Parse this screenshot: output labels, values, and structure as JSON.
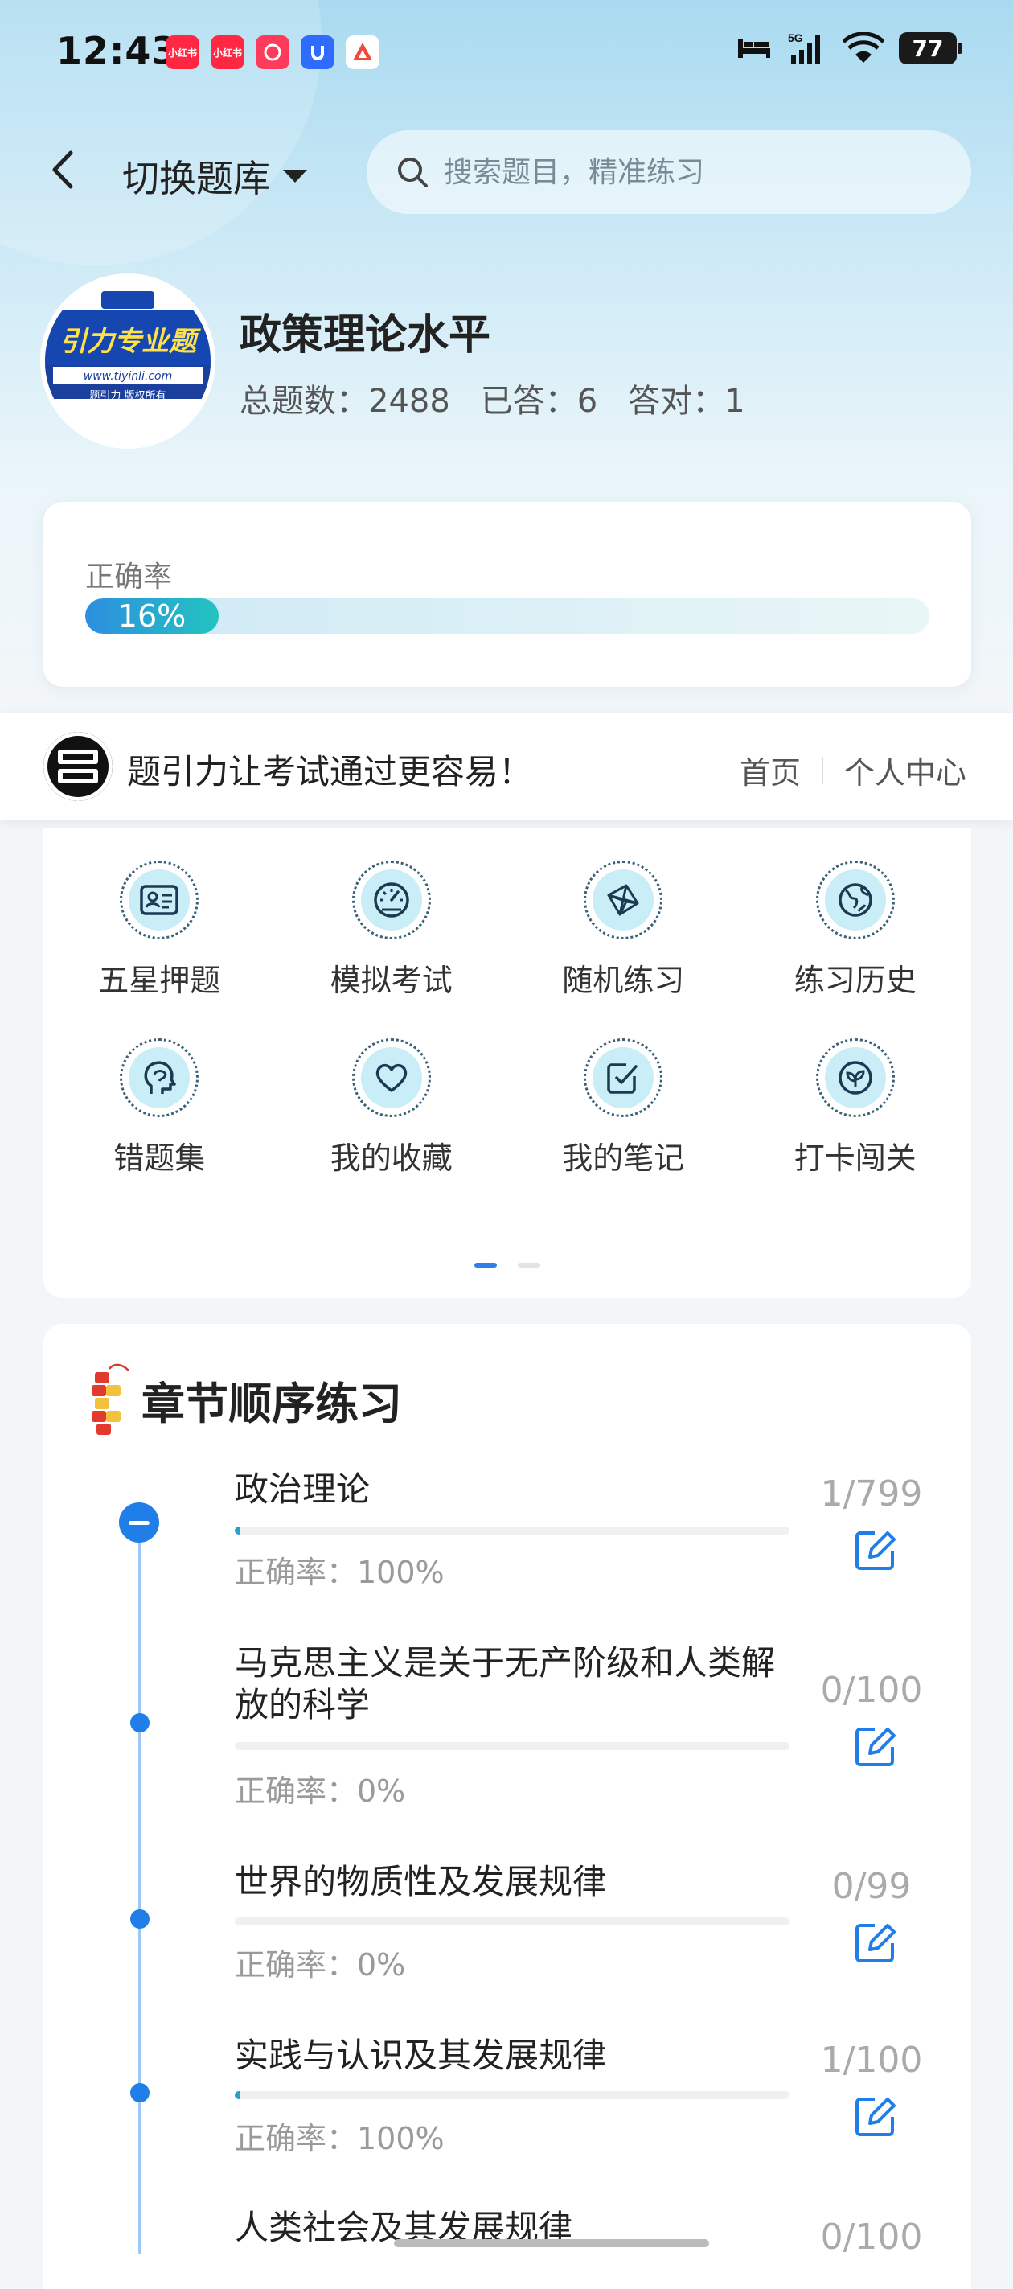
{
  "status_bar": {
    "time": "12:43",
    "apps": [
      {
        "name": "xiaohongshu-1",
        "label": "小红书",
        "color": "#ff2741"
      },
      {
        "name": "xiaohongshu-2",
        "label": "小红书",
        "color": "#ff2741"
      },
      {
        "name": "app-3",
        "label": "",
        "color": "#ff3b5c"
      },
      {
        "name": "app-4",
        "label": "",
        "color": "#2f6bff"
      },
      {
        "name": "app-5",
        "label": "",
        "color": "#f04a3a"
      }
    ],
    "network": "5G",
    "battery": "77"
  },
  "header": {
    "switch_label": "切换题库",
    "search_placeholder": "搜索题目，精准练习"
  },
  "profile": {
    "logo_text": "引力专业题",
    "logo_url_text": "www.tiyinli.com",
    "logo_copyright": "题引力 版权所有",
    "title": "政策理论水平",
    "total_label": "总题数：2488",
    "answered_label": "已答：6",
    "correct_label": "答对：1"
  },
  "accuracy": {
    "label": "正确率",
    "value_text": "16%",
    "value": 0.16
  },
  "banner": {
    "text": "题引力让考试通过更容易！",
    "links": [
      "首页",
      "个人中心"
    ]
  },
  "grid": [
    {
      "label": "五星押题",
      "icon": "id-card-icon"
    },
    {
      "label": "模拟考试",
      "icon": "gauge-icon"
    },
    {
      "label": "随机练习",
      "icon": "random-network-icon"
    },
    {
      "label": "练习历史",
      "icon": "globe-icon"
    },
    {
      "label": "错题集",
      "icon": "head-icon"
    },
    {
      "label": "我的收藏",
      "icon": "heart-icon"
    },
    {
      "label": "我的笔记",
      "icon": "check-note-icon"
    },
    {
      "label": "打卡闯关",
      "icon": "leaf-icon"
    }
  ],
  "chapters": {
    "title": "章节顺序练习",
    "items": [
      {
        "title": "政治理论",
        "accuracy": "正确率：100%",
        "count": "1/799",
        "progress": 0.00125
      },
      {
        "title": "马克思主义是关于无产阶级和人类解放的科学",
        "accuracy": "正确率：0%",
        "count": "0/100",
        "progress": 0
      },
      {
        "title": "世界的物质性及发展规律",
        "accuracy": "正确率：0%",
        "count": "0/99",
        "progress": 0
      },
      {
        "title": "实践与认识及其发展规律",
        "accuracy": "正确率：100%",
        "count": "1/100",
        "progress": 0.01
      },
      {
        "title": "人类社会及其发展规律",
        "accuracy": "",
        "count": "0/100",
        "progress": 0
      }
    ]
  },
  "colors": {
    "accent": "#1f7ee8",
    "teal": "#24c3c0"
  }
}
